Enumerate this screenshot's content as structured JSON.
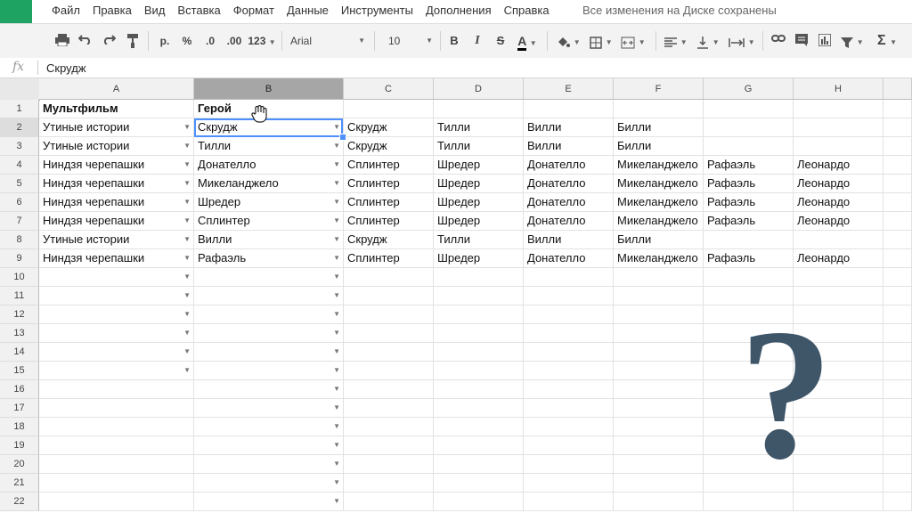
{
  "menu": {
    "items": [
      "Файл",
      "Правка",
      "Вид",
      "Вставка",
      "Формат",
      "Данные",
      "Инструменты",
      "Дополнения",
      "Справка"
    ],
    "save_status": "Все изменения на Диске сохранены"
  },
  "toolbar": {
    "currency": "р.",
    "percent": "%",
    "dec_decrease": ".0",
    "dec_increase": ".00",
    "number_format": "123",
    "font": "Arial",
    "font_size": "10",
    "bold": "B",
    "italic": "I",
    "strike": "S",
    "text_color": "A"
  },
  "formula_bar": {
    "fx": "fx",
    "value": "Скрудж"
  },
  "columns": [
    "A",
    "B",
    "C",
    "D",
    "E",
    "F",
    "G",
    "H"
  ],
  "row_numbers": [
    "1",
    "2",
    "3",
    "4",
    "5",
    "6",
    "7",
    "8",
    "9",
    "10",
    "11",
    "12",
    "13",
    "14",
    "15",
    "16",
    "17",
    "18",
    "19",
    "20",
    "21",
    "22"
  ],
  "rows": [
    [
      "Мультфильм",
      "Герой",
      "",
      "",
      "",
      "",
      "",
      ""
    ],
    [
      "Утиные истории",
      "Скрудж",
      "Скрудж",
      "Тилли",
      "Вилли",
      "Билли",
      "",
      ""
    ],
    [
      "Утиные истории",
      "Тилли",
      "Скрудж",
      "Тилли",
      "Вилли",
      "Билли",
      "",
      ""
    ],
    [
      "Ниндзя черепашки",
      "Донателло",
      "Сплинтер",
      "Шредер",
      "Донателло",
      "Микеланджело",
      "Рафаэль",
      "Леонардо"
    ],
    [
      "Ниндзя черепашки",
      "Микеланджело",
      "Сплинтер",
      "Шредер",
      "Донателло",
      "Микеланджело",
      "Рафаэль",
      "Леонардо"
    ],
    [
      "Ниндзя черепашки",
      "Шредер",
      "Сплинтер",
      "Шредер",
      "Донателло",
      "Микеланджело",
      "Рафаэль",
      "Леонардо"
    ],
    [
      "Ниндзя черепашки",
      "Сплинтер",
      "Сплинтер",
      "Шредер",
      "Донателло",
      "Микеланджело",
      "Рафаэль",
      "Леонардо"
    ],
    [
      "Утиные истории",
      "Вилли",
      "Скрудж",
      "Тилли",
      "Вилли",
      "Билли",
      "",
      ""
    ],
    [
      "Ниндзя черепашки",
      "Рафаэль",
      "Сплинтер",
      "Шредер",
      "Донателло",
      "Микеланджело",
      "Рафаэль",
      "Леонардо"
    ]
  ],
  "overlay": {
    "question_mark": "?"
  },
  "colors": {
    "accent": "#4d90fe",
    "brand": "#1ea362",
    "overlay": "#3f5568"
  }
}
